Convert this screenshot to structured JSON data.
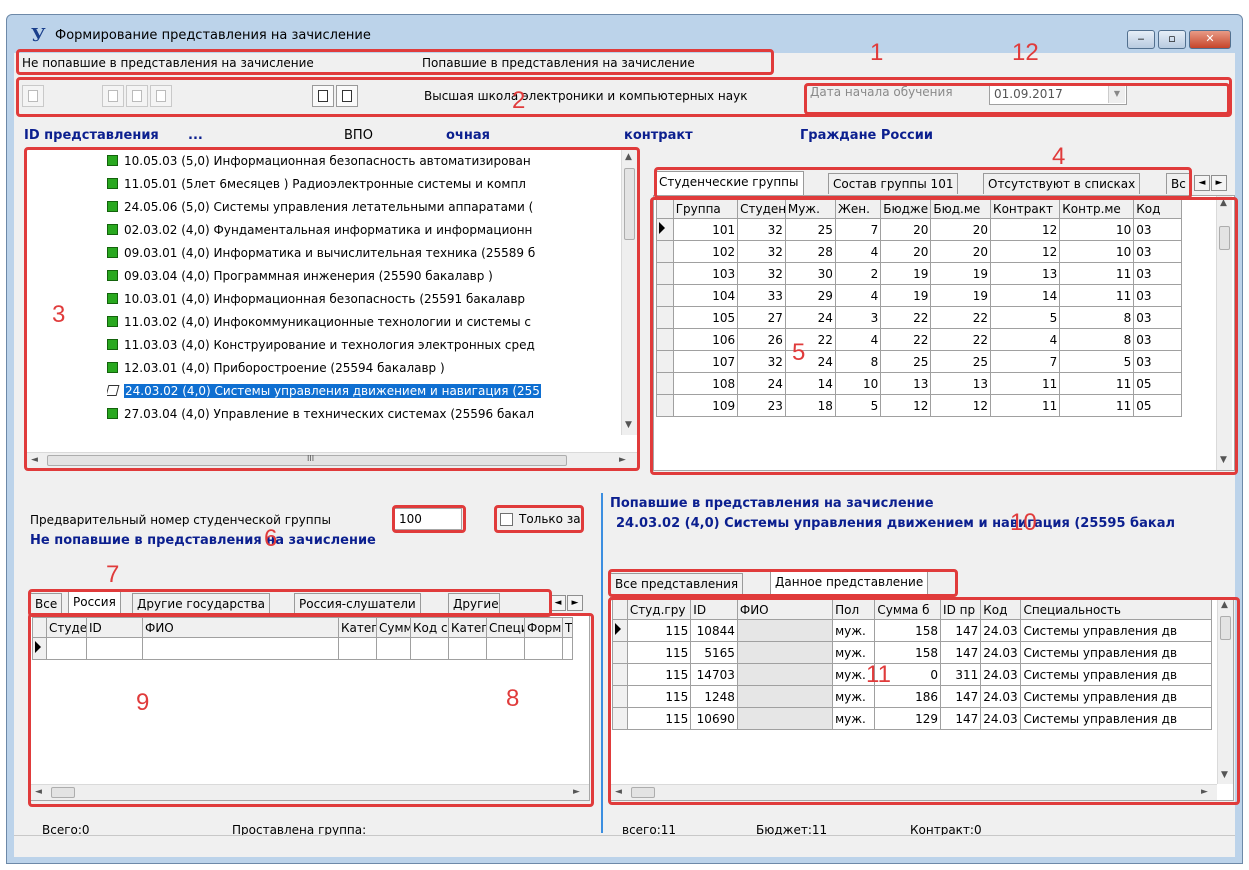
{
  "window": {
    "title": "Формирование представления на зачисление",
    "app_icon": "У",
    "buttons": {
      "minimize": "‒",
      "maximize": "▫",
      "close": "✕"
    }
  },
  "menu": [
    "Не попавшие в представления на зачисление",
    "Попавшие в представления на зачисление"
  ],
  "toolbar": {
    "school": "Высшая школа электроники и компьютерных наук",
    "date_label": "Дата начала обучения",
    "date_value": "01.09.2017"
  },
  "info_row": {
    "id_label": "ID представления",
    "id_value": "...",
    "level": "ВПО",
    "form": "очная",
    "finance": "контракт",
    "citizenship": "Граждане России"
  },
  "tree": {
    "items": [
      "10.05.03 (5,0) Информационная безопасность автоматизирован",
      "11.05.01 (5лет 6месяцев ) Радиоэлектронные системы и компл",
      "24.05.06 (5,0) Системы управления летательными аппаратами (",
      "02.03.02 (4,0) Фундаментальная информатика и информационн",
      "09.03.01 (4,0) Информатика и вычислительная техника (25589 б",
      "09.03.04 (4,0) Программная инженерия (25590 бакалавр )",
      "10.03.01 (4,0) Информационная безопасность (25591 бакалавр",
      "11.03.02 (4,0) Инфокоммуникационные технологии и системы с",
      "11.03.03 (4,0) Конструирование и технология электронных сред",
      "12.03.01 (4,0) Приборостроение (25594 бакалавр )",
      "24.03.02 (4,0) Системы управления движением и навигация (255",
      "27.03.04 (4,0) Управление в технических системах (25596 бакал"
    ],
    "selected_index": 10,
    "scroll_arrows": {
      "up": "▲",
      "down": "▼",
      "left": "◄",
      "right": "►"
    },
    "hscroll_grip": "III"
  },
  "groups_tabs": [
    "Студенческие группы",
    "Состав группы 101",
    "Отсутствуют в списках",
    "Вс"
  ],
  "tab_scroll": {
    "left": "◄",
    "right": "►"
  },
  "groups_table": {
    "columns": [
      "Группа",
      "Студен",
      "Муж.",
      "Жен.",
      "Бюдже",
      "Бюд.ме",
      "Контракт",
      "Контр.ме",
      "Код"
    ],
    "rows": [
      [
        "101",
        "32",
        "25",
        "7",
        "20",
        "20",
        "12",
        "10",
        "03"
      ],
      [
        "102",
        "32",
        "28",
        "4",
        "20",
        "20",
        "12",
        "10",
        "03"
      ],
      [
        "103",
        "32",
        "30",
        "2",
        "19",
        "19",
        "13",
        "11",
        "03"
      ],
      [
        "104",
        "33",
        "29",
        "4",
        "19",
        "19",
        "14",
        "11",
        "03"
      ],
      [
        "105",
        "27",
        "24",
        "3",
        "22",
        "22",
        "5",
        "8",
        "03"
      ],
      [
        "106",
        "26",
        "22",
        "4",
        "22",
        "22",
        "4",
        "8",
        "03"
      ],
      [
        "107",
        "32",
        "24",
        "8",
        "25",
        "25",
        "7",
        "5",
        "03"
      ],
      [
        "108",
        "24",
        "14",
        "10",
        "13",
        "13",
        "11",
        "11",
        "05"
      ],
      [
        "109",
        "23",
        "18",
        "5",
        "12",
        "12",
        "11",
        "11",
        "05"
      ]
    ]
  },
  "left_bottom": {
    "prelim_label": "Предварительный номер студенческой группы",
    "prelim_value": "100",
    "only_label": "Только за",
    "heading": "Не попавшие в представления на зачисление",
    "tabs": [
      "Все",
      "Россия",
      "Другие государства",
      "Россия-слушатели",
      "Другие"
    ],
    "columns": [
      "Студе",
      "ID",
      "ФИО",
      "Катег",
      "Сумм",
      "Код с",
      "Катег",
      "Специ",
      "Форм",
      "Т"
    ],
    "total": "Всего:0",
    "group_set": "Проставлена группа:"
  },
  "right_bottom": {
    "heading1": "Попавшие в представления на зачисление",
    "heading2": "24.03.02 (4,0) Системы управления движением и навигация (25595 бакал",
    "tabs": [
      "Все представления",
      "Данное представление"
    ],
    "columns": [
      "Студ.гру",
      "ID",
      "ФИО",
      "Пол",
      "Сумма б",
      "ID пр",
      "Код",
      "Специальность"
    ],
    "rows": [
      [
        "115",
        "10844",
        "",
        "муж.",
        "158",
        "147",
        "24.03",
        "Системы управления дв"
      ],
      [
        "115",
        "5165",
        "",
        "муж.",
        "158",
        "147",
        "24.03",
        "Системы управления дв"
      ],
      [
        "115",
        "14703",
        "",
        "муж.",
        "0",
        "311",
        "24.03",
        "Системы управления дв"
      ],
      [
        "115",
        "1248",
        "",
        "муж.",
        "186",
        "147",
        "24.03",
        "Системы управления дв"
      ],
      [
        "115",
        "10690",
        "",
        "муж.",
        "129",
        "147",
        "24.03",
        "Системы управления дв"
      ]
    ],
    "total": "всего:11",
    "budget": "Бюджет:11",
    "contract": "Контракт:0"
  },
  "callouts": [
    "1",
    "2",
    "3",
    "4",
    "5",
    "6",
    "7",
    "8",
    "9",
    "10",
    "11",
    "12"
  ],
  "accent_color": "#e03b3b",
  "selection_color": "#0f6fd1",
  "heading_color": "#0b1f8f"
}
